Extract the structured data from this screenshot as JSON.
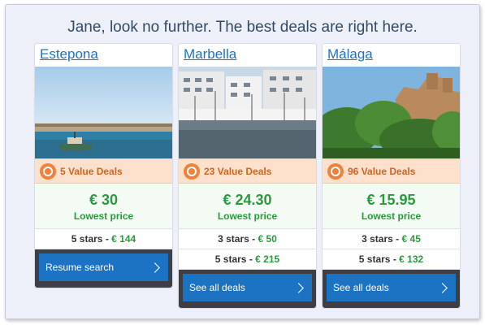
{
  "headline": "Jane, look no further. The best deals are right here.",
  "cards": [
    {
      "city": "Estepona",
      "image": "harbor-breakwater-boat",
      "deals": "5 Value Deals",
      "price": "€ 30",
      "price_label": "Lowest price",
      "rows": [
        {
          "stars": "5 stars",
          "sep": "-",
          "price": "€ 144"
        }
      ],
      "button": "Resume search"
    },
    {
      "city": "Marbella",
      "image": "marina-white-buildings",
      "deals": "23 Value Deals",
      "price": "€ 24.30",
      "price_label": "Lowest price",
      "rows": [
        {
          "stars": "3 stars",
          "sep": "-",
          "price": "€ 50"
        },
        {
          "stars": "5 stars",
          "sep": "-",
          "price": "€ 215"
        }
      ],
      "button": "See all deals"
    },
    {
      "city": "Málaga",
      "image": "alcazaba-fortress-gardens",
      "deals": "96 Value Deals",
      "price": "€ 15.95",
      "price_label": "Lowest price",
      "rows": [
        {
          "stars": "3 stars",
          "sep": "-",
          "price": "€ 45"
        },
        {
          "stars": "5 stars",
          "sep": "-",
          "price": "€ 132"
        }
      ],
      "button": "See all deals"
    }
  ],
  "colors": {
    "link": "#1c73c4",
    "deal_orange": "#d2641e",
    "price_green": "#2a9a3c",
    "button_blue": "#1c73c4"
  }
}
